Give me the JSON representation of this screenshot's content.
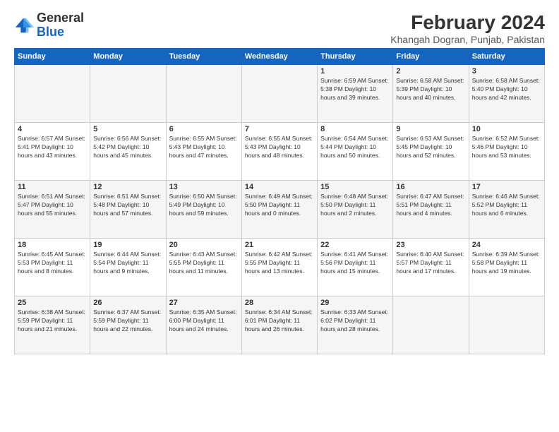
{
  "header": {
    "logo_general": "General",
    "logo_blue": "Blue",
    "month_year": "February 2024",
    "location": "Khangah Dogran, Punjab, Pakistan"
  },
  "days_of_week": [
    "Sunday",
    "Monday",
    "Tuesday",
    "Wednesday",
    "Thursday",
    "Friday",
    "Saturday"
  ],
  "weeks": [
    [
      {
        "day": "",
        "info": ""
      },
      {
        "day": "",
        "info": ""
      },
      {
        "day": "",
        "info": ""
      },
      {
        "day": "",
        "info": ""
      },
      {
        "day": "1",
        "info": "Sunrise: 6:59 AM\nSunset: 5:38 PM\nDaylight: 10 hours\nand 39 minutes."
      },
      {
        "day": "2",
        "info": "Sunrise: 6:58 AM\nSunset: 5:39 PM\nDaylight: 10 hours\nand 40 minutes."
      },
      {
        "day": "3",
        "info": "Sunrise: 6:58 AM\nSunset: 5:40 PM\nDaylight: 10 hours\nand 42 minutes."
      }
    ],
    [
      {
        "day": "4",
        "info": "Sunrise: 6:57 AM\nSunset: 5:41 PM\nDaylight: 10 hours\nand 43 minutes."
      },
      {
        "day": "5",
        "info": "Sunrise: 6:56 AM\nSunset: 5:42 PM\nDaylight: 10 hours\nand 45 minutes."
      },
      {
        "day": "6",
        "info": "Sunrise: 6:55 AM\nSunset: 5:43 PM\nDaylight: 10 hours\nand 47 minutes."
      },
      {
        "day": "7",
        "info": "Sunrise: 6:55 AM\nSunset: 5:43 PM\nDaylight: 10 hours\nand 48 minutes."
      },
      {
        "day": "8",
        "info": "Sunrise: 6:54 AM\nSunset: 5:44 PM\nDaylight: 10 hours\nand 50 minutes."
      },
      {
        "day": "9",
        "info": "Sunrise: 6:53 AM\nSunset: 5:45 PM\nDaylight: 10 hours\nand 52 minutes."
      },
      {
        "day": "10",
        "info": "Sunrise: 6:52 AM\nSunset: 5:46 PM\nDaylight: 10 hours\nand 53 minutes."
      }
    ],
    [
      {
        "day": "11",
        "info": "Sunrise: 6:51 AM\nSunset: 5:47 PM\nDaylight: 10 hours\nand 55 minutes."
      },
      {
        "day": "12",
        "info": "Sunrise: 6:51 AM\nSunset: 5:48 PM\nDaylight: 10 hours\nand 57 minutes."
      },
      {
        "day": "13",
        "info": "Sunrise: 6:50 AM\nSunset: 5:49 PM\nDaylight: 10 hours\nand 59 minutes."
      },
      {
        "day": "14",
        "info": "Sunrise: 6:49 AM\nSunset: 5:50 PM\nDaylight: 11 hours\nand 0 minutes."
      },
      {
        "day": "15",
        "info": "Sunrise: 6:48 AM\nSunset: 5:50 PM\nDaylight: 11 hours\nand 2 minutes."
      },
      {
        "day": "16",
        "info": "Sunrise: 6:47 AM\nSunset: 5:51 PM\nDaylight: 11 hours\nand 4 minutes."
      },
      {
        "day": "17",
        "info": "Sunrise: 6:46 AM\nSunset: 5:52 PM\nDaylight: 11 hours\nand 6 minutes."
      }
    ],
    [
      {
        "day": "18",
        "info": "Sunrise: 6:45 AM\nSunset: 5:53 PM\nDaylight: 11 hours\nand 8 minutes."
      },
      {
        "day": "19",
        "info": "Sunrise: 6:44 AM\nSunset: 5:54 PM\nDaylight: 11 hours\nand 9 minutes."
      },
      {
        "day": "20",
        "info": "Sunrise: 6:43 AM\nSunset: 5:55 PM\nDaylight: 11 hours\nand 11 minutes."
      },
      {
        "day": "21",
        "info": "Sunrise: 6:42 AM\nSunset: 5:55 PM\nDaylight: 11 hours\nand 13 minutes."
      },
      {
        "day": "22",
        "info": "Sunrise: 6:41 AM\nSunset: 5:56 PM\nDaylight: 11 hours\nand 15 minutes."
      },
      {
        "day": "23",
        "info": "Sunrise: 6:40 AM\nSunset: 5:57 PM\nDaylight: 11 hours\nand 17 minutes."
      },
      {
        "day": "24",
        "info": "Sunrise: 6:39 AM\nSunset: 5:58 PM\nDaylight: 11 hours\nand 19 minutes."
      }
    ],
    [
      {
        "day": "25",
        "info": "Sunrise: 6:38 AM\nSunset: 5:59 PM\nDaylight: 11 hours\nand 21 minutes."
      },
      {
        "day": "26",
        "info": "Sunrise: 6:37 AM\nSunset: 5:59 PM\nDaylight: 11 hours\nand 22 minutes."
      },
      {
        "day": "27",
        "info": "Sunrise: 6:35 AM\nSunset: 6:00 PM\nDaylight: 11 hours\nand 24 minutes."
      },
      {
        "day": "28",
        "info": "Sunrise: 6:34 AM\nSunset: 6:01 PM\nDaylight: 11 hours\nand 26 minutes."
      },
      {
        "day": "29",
        "info": "Sunrise: 6:33 AM\nSunset: 6:02 PM\nDaylight: 11 hours\nand 28 minutes."
      },
      {
        "day": "",
        "info": ""
      },
      {
        "day": "",
        "info": ""
      }
    ]
  ]
}
